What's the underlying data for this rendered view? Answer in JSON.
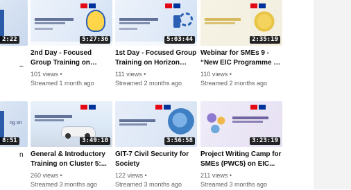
{
  "videos": [
    {
      "duration": "2:22",
      "title": "",
      "views": "",
      "streamed": ""
    },
    {
      "duration": "5:27:36",
      "title": "2nd Day - Focused Group Training on Horizon Euro...",
      "views": "101 views",
      "streamed": "Streamed 1 month ago"
    },
    {
      "duration": "5:03:44",
      "title": "1st Day - Focused Group Training on Horizon Euro...",
      "views": "111 views",
      "streamed": "Streamed 2 months ago"
    },
    {
      "duration": "2:35:19",
      "title": "Webinar for SMEs 9 - “New EIC Programme – What’s ...",
      "views": "110 views",
      "streamed": "Streamed 2 months ago"
    },
    {
      "duration": "8:51",
      "title": "",
      "views": "",
      "streamed": ""
    },
    {
      "duration": "3:49:10",
      "title": "General & Introductory Training on Cluster 5:...",
      "views": "260 views",
      "streamed": "Streamed 3 months ago"
    },
    {
      "duration": "3:56:58",
      "title": "GIT-7 Civil Security for Society",
      "views": "122 views",
      "streamed": "Streamed 3 months ago"
    },
    {
      "duration": "3:23:19",
      "title": "Project Writing Camp for SMEs (PWC5) on EIC...",
      "views": "211 views",
      "streamed": "Streamed 3 months ago"
    }
  ],
  "partial_text": {
    "left1": "–",
    "left2a": "ng on",
    "left2b": "n"
  },
  "colors": {
    "text_primary": "#0f0f0f",
    "text_secondary": "#606060",
    "flag_tr": "#e30a17",
    "flag_eu": "#003399",
    "duration_bg": "#000000"
  }
}
